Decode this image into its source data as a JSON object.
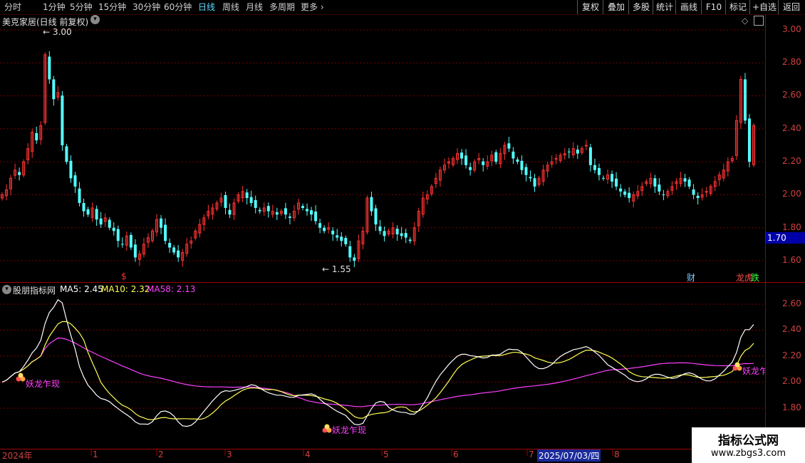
{
  "toolbar": {
    "periods": [
      "分时",
      "1分钟",
      "5分钟",
      "15分钟",
      "30分钟",
      "60分钟",
      "日线",
      "周线",
      "月线",
      "多周期",
      "更多 ›"
    ],
    "active_period": "日线",
    "right_buttons": [
      "复权",
      "叠加",
      "多股",
      "统计",
      "画线",
      "F10",
      "标记",
      "+自选",
      "返回"
    ]
  },
  "main_panel": {
    "title": "美克家居(日线 前复权)",
    "high_label": "3.00",
    "low_label": "1.55",
    "price_badge": "1.70",
    "y_ticks": [
      "3.00",
      "2.80",
      "2.60",
      "2.40",
      "2.20",
      "2.00",
      "1.80",
      "1.60"
    ],
    "markers": {
      "dollar": "$",
      "cai": "财",
      "longhu": "龙虎",
      "die": "跌"
    }
  },
  "indicator_panel": {
    "title": "股朋指标网",
    "ma5_label": "MA5:",
    "ma5_value": "2.45",
    "ma10_label": "MA10:",
    "ma10_value": "2.32",
    "ma58_label": "MA58:",
    "ma58_value": "2.13",
    "y_ticks": [
      "2.60",
      "2.40",
      "2.20",
      "2.00",
      "1.80"
    ],
    "signal_text_1": "妖龙乍现",
    "signal_text_2": "妖龙乍现",
    "signal_text_3": "妖龙乍"
  },
  "x_axis": {
    "labels": [
      "2024年",
      "1",
      "2",
      "3",
      "4",
      "5",
      "6",
      "7",
      "8"
    ],
    "cursor_date": "2025/07/03/四"
  },
  "watermark": {
    "title": "指标公式网",
    "url": "www.zbgs3.com"
  },
  "colors": {
    "up": "#ff3232",
    "down": "#54ffff",
    "ma5": "#ffffff",
    "ma10": "#ffff55",
    "ma58": "#ff40ff",
    "grid": "#7a0000"
  },
  "chart_data": {
    "type": "candlestick",
    "close": [
      2.0,
      2.03,
      2.1,
      2.15,
      2.12,
      2.2,
      2.28,
      2.38,
      2.33,
      2.42,
      2.85,
      2.7,
      2.58,
      2.62,
      2.3,
      2.2,
      2.1,
      2.05,
      1.95,
      1.9,
      1.88,
      1.92,
      1.85,
      1.82,
      1.86,
      1.8,
      1.78,
      1.72,
      1.7,
      1.75,
      1.68,
      1.62,
      1.64,
      1.7,
      1.74,
      1.78,
      1.85,
      1.8,
      1.72,
      1.68,
      1.65,
      1.62,
      1.65,
      1.7,
      1.72,
      1.78,
      1.82,
      1.86,
      1.9,
      1.92,
      1.95,
      1.98,
      1.92,
      1.88,
      1.95,
      2.0,
      2.02,
      1.98,
      1.95,
      1.92,
      1.9,
      1.92,
      1.9,
      1.9,
      1.88,
      1.9,
      1.88,
      1.86,
      1.9,
      1.95,
      1.92,
      1.9,
      1.88,
      1.84,
      1.8,
      1.78,
      1.8,
      1.76,
      1.74,
      1.72,
      1.7,
      1.62,
      1.6,
      1.72,
      1.78,
      1.98,
      1.9,
      1.82,
      1.78,
      1.75,
      1.78,
      1.8,
      1.76,
      1.75,
      1.74,
      1.72,
      1.8,
      1.9,
      1.98,
      2.0,
      2.05,
      2.1,
      2.15,
      2.18,
      2.2,
      2.22,
      2.25,
      2.22,
      2.18,
      2.15,
      2.2,
      2.22,
      2.18,
      2.2,
      2.24,
      2.2,
      2.25,
      2.3,
      2.28,
      2.22,
      2.2,
      2.15,
      2.12,
      2.1,
      2.05,
      2.1,
      2.15,
      2.18,
      2.2,
      2.22,
      2.24,
      2.25,
      2.26,
      2.28,
      2.25,
      2.28,
      2.3,
      2.18,
      2.15,
      2.12,
      2.1,
      2.12,
      2.08,
      2.05,
      2.02,
      2.0,
      1.98,
      2.0,
      2.02,
      2.05,
      2.08,
      2.1,
      2.05,
      2.02,
      2.0,
      2.02,
      2.05,
      2.08,
      2.1,
      2.08,
      2.05,
      2.0,
      1.98,
      2.0,
      2.02,
      2.05,
      2.08,
      2.12,
      2.15,
      2.2,
      2.22,
      2.45,
      2.7,
      2.45,
      2.2,
      2.42
    ],
    "y_range": [
      1.55,
      3.05
    ],
    "indicator": {
      "ma5": 2.45,
      "ma10": 2.32,
      "ma58": 2.13,
      "y_range": [
        1.62,
        2.72
      ]
    }
  }
}
